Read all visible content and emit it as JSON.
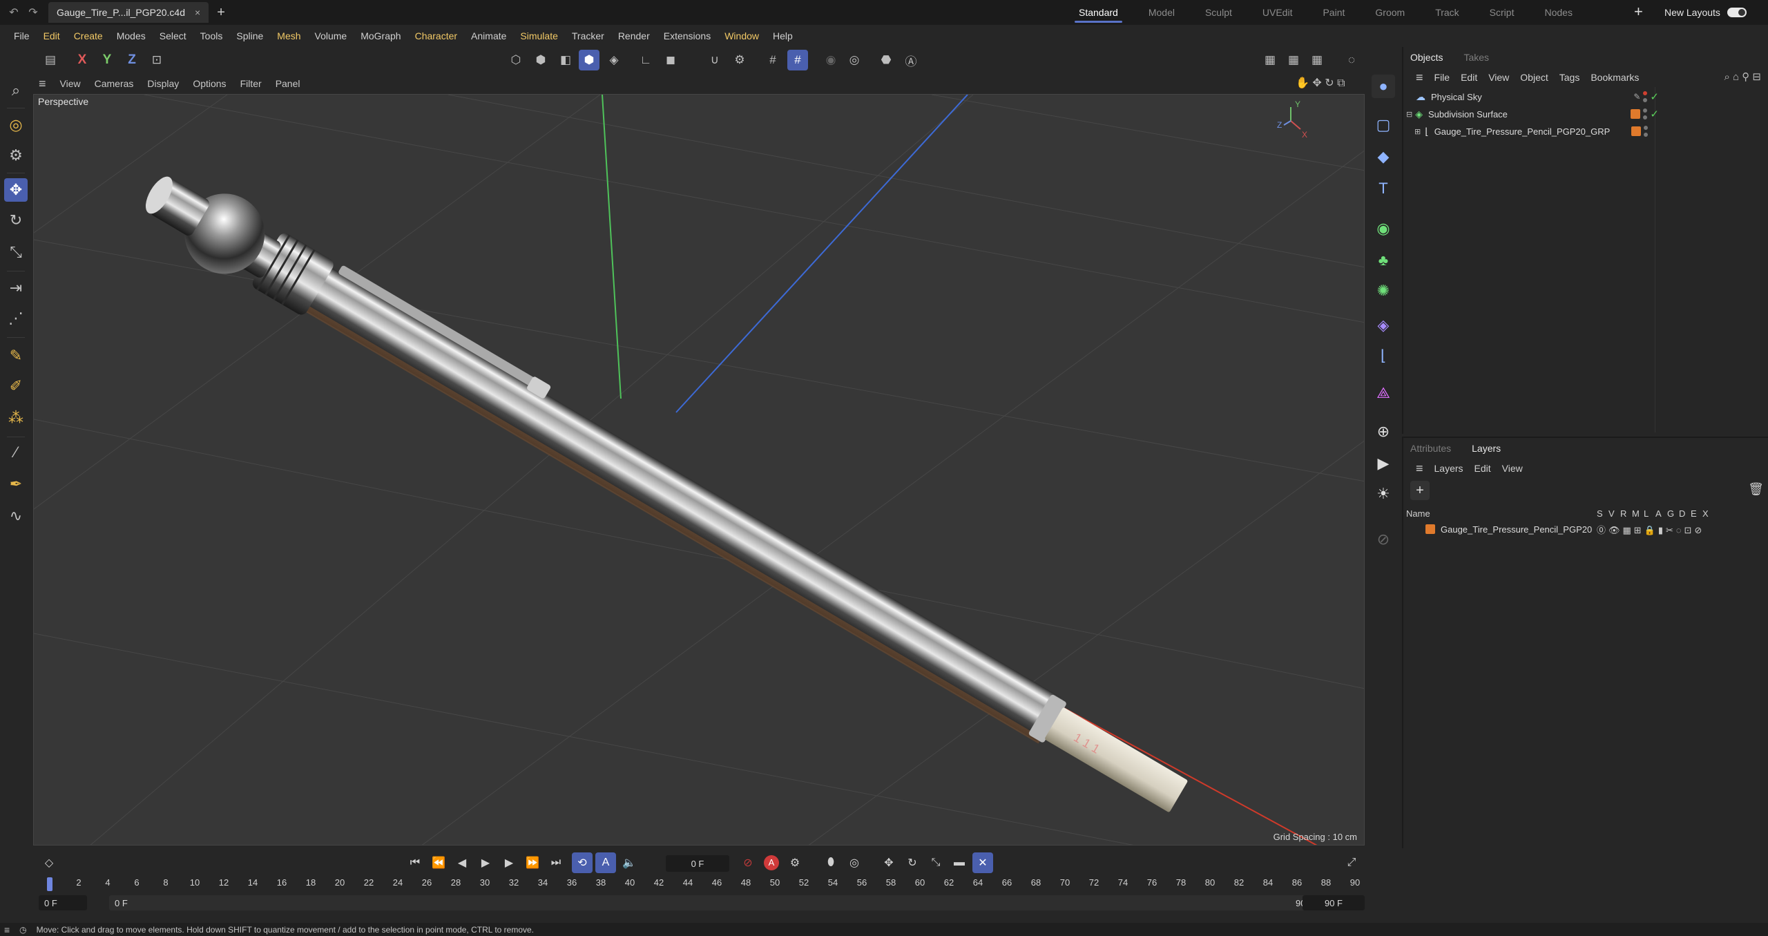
{
  "tabbar": {
    "undo_icon": "undo-icon",
    "redo_icon": "redo-icon",
    "file_tab": "Gauge_Tire_P...il_PGP20.c4d",
    "close": "×",
    "add": "+",
    "layouts": [
      "Standard",
      "Model",
      "Sculpt",
      "UVEdit",
      "Paint",
      "Groom",
      "Track",
      "Script",
      "Nodes"
    ],
    "layout_plus": "+",
    "new_layouts": "New Layouts"
  },
  "menu": [
    "File",
    "Edit",
    "Create",
    "Modes",
    "Select",
    "Tools",
    "Spline",
    "Mesh",
    "Volume",
    "MoGraph",
    "Character",
    "Animate",
    "Simulate",
    "Tracker",
    "Render",
    "Extensions",
    "Window",
    "Help"
  ],
  "menu_accent": [
    "Edit",
    "Create",
    "Mesh",
    "Character",
    "Simulate",
    "Window"
  ],
  "toolbar": {
    "x": "X",
    "y": "Y",
    "z": "Z"
  },
  "viewport": {
    "menu": [
      "View",
      "Cameras",
      "Display",
      "Options",
      "Filter",
      "Panel"
    ],
    "label": "Perspective",
    "grid_spacing": "Grid Spacing : 10 cm"
  },
  "objects": {
    "tabs": [
      "Objects",
      "Takes"
    ],
    "menu": [
      "File",
      "Edit",
      "View",
      "Object",
      "Tags",
      "Bookmarks"
    ],
    "items": [
      {
        "name": "Physical Sky",
        "indent": 0
      },
      {
        "name": "Subdivision Surface",
        "indent": 0
      },
      {
        "name": "Gauge_Tire_Pressure_Pencil_PGP20_GRP",
        "indent": 1
      }
    ]
  },
  "layers": {
    "tabs": [
      "Attributes",
      "Layers"
    ],
    "menu": [
      "Layers",
      "Edit",
      "View"
    ],
    "col_name": "Name",
    "flags": [
      "S",
      "V",
      "R",
      "M",
      "L",
      "A",
      "G",
      "D",
      "E",
      "X"
    ],
    "items": [
      {
        "name": "Gauge_Tire_Pressure_Pencil_PGP20"
      }
    ]
  },
  "timeline": {
    "current_frame": "0 F",
    "ticks": [
      0,
      2,
      4,
      6,
      8,
      10,
      12,
      14,
      16,
      18,
      20,
      22,
      24,
      26,
      28,
      30,
      32,
      34,
      36,
      38,
      40,
      42,
      44,
      46,
      48,
      50,
      52,
      54,
      56,
      58,
      60,
      62,
      64,
      66,
      68,
      70,
      72,
      74,
      76,
      78,
      80,
      82,
      84,
      86,
      88,
      90
    ],
    "start": "0 F",
    "preview_start": "0 F",
    "preview_end": "90 F",
    "end": "90 F"
  },
  "status": "Move: Click and drag to move elements. Hold down SHIFT to quantize movement / add to the selection in point mode, CTRL to remove.",
  "colors": {
    "accent": "#4a5fae",
    "menu_accent": "#f2c966",
    "layer_orange": "#e07a2c",
    "check_green": "#5bd35b"
  }
}
